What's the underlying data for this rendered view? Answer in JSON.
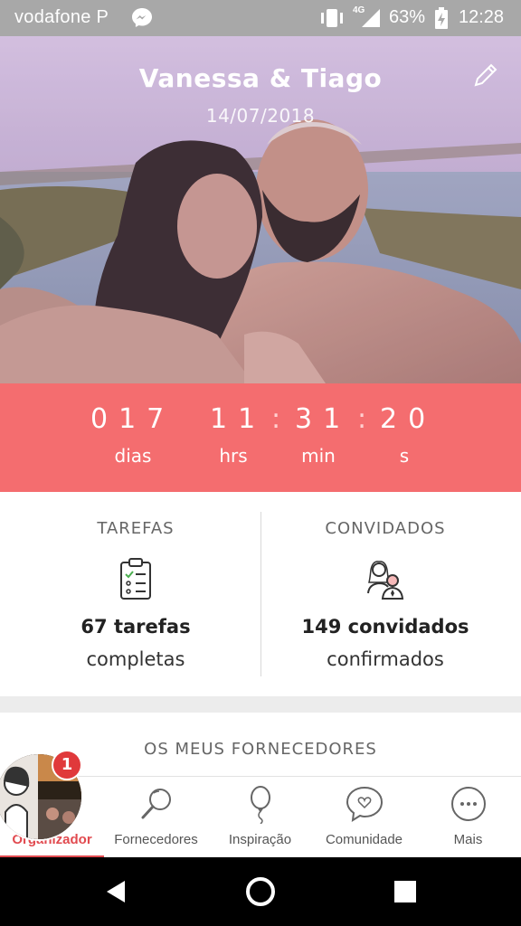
{
  "status_bar": {
    "carrier": "vodafone P",
    "network": "4G",
    "battery_percent": "63%",
    "time": "12:28"
  },
  "hero": {
    "couple_names": "Vanessa & Tiago",
    "wedding_date": "14/07/2018"
  },
  "countdown": {
    "days": "017",
    "hours": "11",
    "minutes": "31",
    "seconds": "20",
    "separator": ":",
    "labels": {
      "days": "dias",
      "hours": "hrs",
      "minutes": "min",
      "seconds": "s"
    }
  },
  "stats": {
    "tasks": {
      "title": "TAREFAS",
      "value": "67 tarefas",
      "sub": "completas",
      "icon": "clipboard-checklist-icon"
    },
    "guests": {
      "title": "CONVIDADOS",
      "value": "149 convidados",
      "sub": "confirmados",
      "icon": "guests-couple-icon"
    }
  },
  "vendors": {
    "title": "OS MEUS FORNECEDORES"
  },
  "bottom_nav": {
    "active_index": 0,
    "notification_badge": "1",
    "items": [
      {
        "label": "Organizador",
        "icon": "avatar-photo"
      },
      {
        "label": "Fornecedores",
        "icon": "magnifier-icon"
      },
      {
        "label": "Inspiração",
        "icon": "balloon-icon"
      },
      {
        "label": "Comunidade",
        "icon": "chat-heart-icon"
      },
      {
        "label": "Mais",
        "icon": "more-dots-icon"
      }
    ]
  },
  "colors": {
    "accent": "#f46d6f",
    "active_nav": "#e14a4f",
    "badge": "#e0393b",
    "status_bar": "#a8a8a8"
  }
}
